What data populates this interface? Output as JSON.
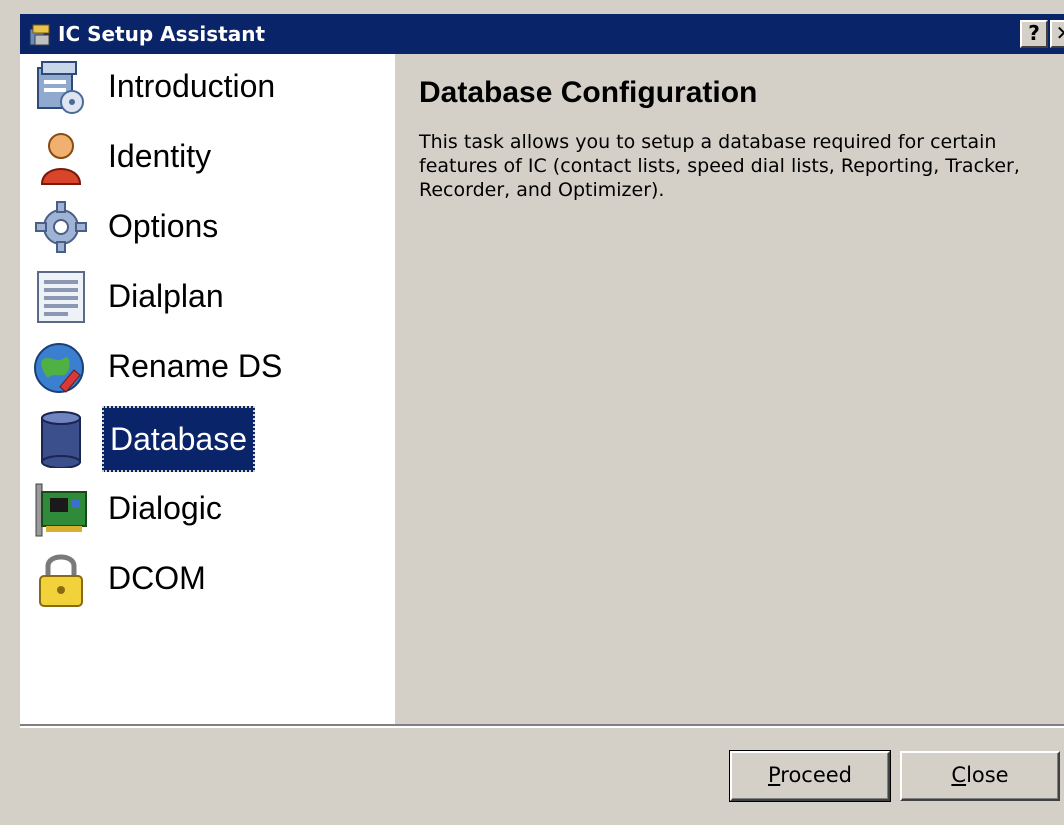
{
  "window": {
    "title": "IC Setup Assistant",
    "help_glyph": "?",
    "close_glyph": "✕"
  },
  "nav": {
    "items": [
      {
        "label": "Introduction",
        "icon": "installer-box-icon",
        "selected": false
      },
      {
        "label": "Identity",
        "icon": "user-person-icon",
        "selected": false
      },
      {
        "label": "Options",
        "icon": "gear-icon",
        "selected": false
      },
      {
        "label": "Dialplan",
        "icon": "document-list-icon",
        "selected": false
      },
      {
        "label": "Rename DS",
        "icon": "globe-pencil-icon",
        "selected": false
      },
      {
        "label": "Database",
        "icon": "database-cylinder-icon",
        "selected": true
      },
      {
        "label": "Dialogic",
        "icon": "expansion-card-icon",
        "selected": false
      },
      {
        "label": "DCOM",
        "icon": "padlock-icon",
        "selected": false
      }
    ]
  },
  "content": {
    "heading": "Database Configuration",
    "description": "This task allows you to setup a database required for certain features of IC (contact lists, speed dial lists, Reporting, Tracker, Recorder, and Optimizer)."
  },
  "buttons": {
    "proceed": {
      "mnemonic": "P",
      "rest": "roceed"
    },
    "close": {
      "mnemonic": "C",
      "rest": "lose"
    }
  },
  "colors": {
    "titlebar": "#0a246a",
    "selection": "#0a246a",
    "face": "#d4d0c8",
    "nav_background": "#ffffff"
  }
}
